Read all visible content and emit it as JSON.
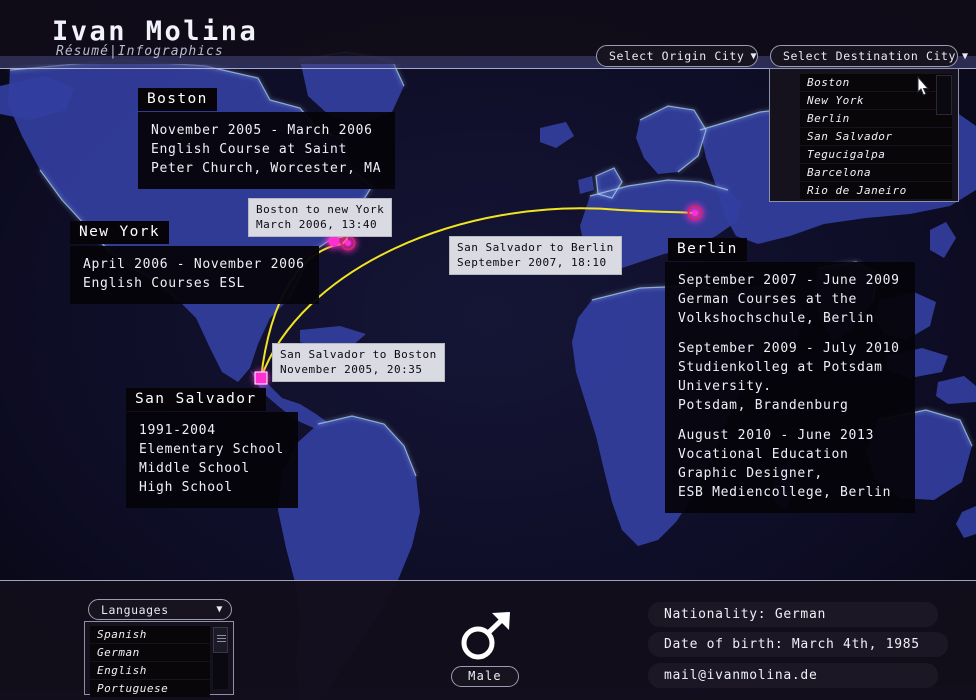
{
  "header": {
    "title": "Ivan Molina",
    "subtitle": "Résumé|Infographics"
  },
  "top_controls": {
    "origin_select": {
      "label": "Select Origin City",
      "caret": "chevron-down-icon"
    },
    "destination_select": {
      "label": "Select Destination City",
      "caret": "chevron-down-icon"
    },
    "destination_options": [
      "Boston",
      "New York",
      "Berlin",
      "San Salvador",
      "Tegucigalpa",
      "Barcelona",
      "Rio de Janeiro"
    ]
  },
  "cities": {
    "boston": {
      "tag": "Boston",
      "lines": [
        [
          "November 2005 - March 2006",
          "English Course at Saint",
          "Peter Church, Worcester, MA"
        ]
      ]
    },
    "new_york": {
      "tag": "New York",
      "lines": [
        [
          "April 2006 - November 2006",
          "English Courses ESL"
        ]
      ]
    },
    "san_salvador": {
      "tag": "San Salvador",
      "lines": [
        [
          "1991-2004",
          "Elementary School",
          "Middle School",
          "High School"
        ]
      ]
    },
    "berlin": {
      "tag": "Berlin",
      "lines": [
        [
          "September 2007 - June 2009",
          "German Courses at the",
          "Volkshochschule, Berlin"
        ],
        [
          "September 2009 - July 2010",
          "Studienkolleg at Potsdam",
          "University.",
          "Potsdam, Brandenburg"
        ],
        [
          "August 2010 - June 2013",
          "Vocational Education",
          "Graphic Designer,",
          "ESB Mediencollege, Berlin"
        ]
      ]
    }
  },
  "flights": {
    "boston_to_new_york": {
      "route": "Boston to new York",
      "when": "March 2006, 13:40"
    },
    "san_salvador_to_berlin": {
      "route": "San Salvador to Berlin",
      "when": "September 2007, 18:10"
    },
    "san_salvador_to_boston": {
      "route": "San Salvador to Boston",
      "when": "November 2005, 20:35"
    }
  },
  "bottom": {
    "languages_select": {
      "label": "Languages",
      "caret": "chevron-down-icon"
    },
    "languages_options": [
      "Spanish",
      "German",
      "English",
      "Portuguese"
    ],
    "gender": {
      "symbol": "male-symbol-icon",
      "label": "Male"
    },
    "nationality": "Nationality: German",
    "date_of_birth": "Date of birth: March 4th, 1985",
    "email": "mail@ivanmolina.de"
  },
  "colors": {
    "route_line": "#f2e41f",
    "marker_core": "#ff2fd0",
    "marker_ring": "#d4246a",
    "land": "#3a44a8",
    "ocean": "#0b0a1f",
    "panel": "#060409"
  }
}
